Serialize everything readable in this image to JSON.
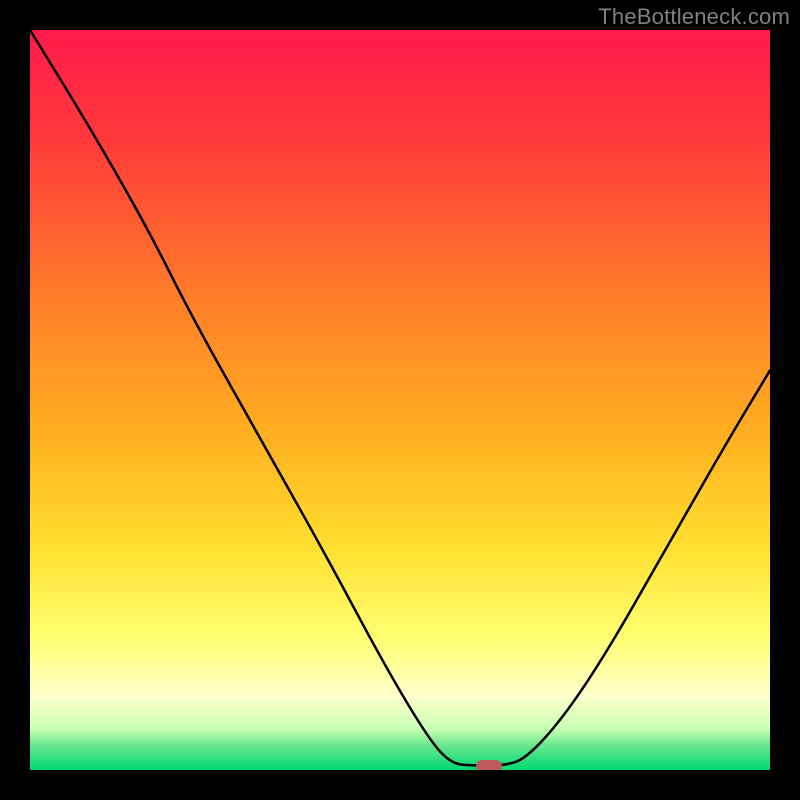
{
  "watermark": "TheBottleneck.com",
  "colors": {
    "frame": "#000000",
    "watermark": "#808080",
    "curve": "#000000",
    "marker": "#c05a5a",
    "gradient_stops": [
      {
        "y": 0.0,
        "color": "#ff1a4a"
      },
      {
        "y": 0.15,
        "color": "#ff3a3a"
      },
      {
        "y": 0.35,
        "color": "#ff7a2a"
      },
      {
        "y": 0.55,
        "color": "#ffb020"
      },
      {
        "y": 0.7,
        "color": "#ffe030"
      },
      {
        "y": 0.82,
        "color": "#ffff70"
      },
      {
        "y": 0.9,
        "color": "#ffffcc"
      },
      {
        "y": 0.945,
        "color": "#c8ffb4"
      },
      {
        "y": 0.965,
        "color": "#70e890"
      },
      {
        "y": 1.0,
        "color": "#00d872"
      }
    ]
  },
  "chart_data": {
    "type": "line",
    "title": "",
    "xlabel": "",
    "ylabel": "",
    "xlim": [
      0,
      1
    ],
    "ylim": [
      0,
      100
    ],
    "curve": [
      {
        "x": 0.0,
        "y": 100.0
      },
      {
        "x": 0.08,
        "y": 87.0
      },
      {
        "x": 0.16,
        "y": 73.0
      },
      {
        "x": 0.22,
        "y": 61.0
      },
      {
        "x": 0.31,
        "y": 45.0
      },
      {
        "x": 0.4,
        "y": 29.0
      },
      {
        "x": 0.48,
        "y": 14.0
      },
      {
        "x": 0.54,
        "y": 4.0
      },
      {
        "x": 0.57,
        "y": 0.8
      },
      {
        "x": 0.6,
        "y": 0.6
      },
      {
        "x": 0.64,
        "y": 0.6
      },
      {
        "x": 0.67,
        "y": 1.5
      },
      {
        "x": 0.72,
        "y": 7.0
      },
      {
        "x": 0.78,
        "y": 16.0
      },
      {
        "x": 0.86,
        "y": 30.0
      },
      {
        "x": 0.94,
        "y": 44.0
      },
      {
        "x": 1.0,
        "y": 54.0
      }
    ],
    "marker": {
      "x": 0.62,
      "y": 0.6,
      "width_frac": 0.035
    }
  }
}
